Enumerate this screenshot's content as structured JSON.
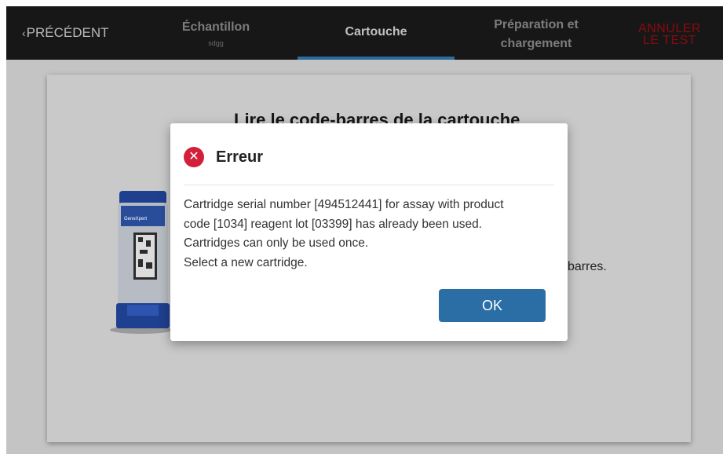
{
  "nav": {
    "back_label": "PRÉCÉDENT",
    "steps": [
      {
        "title": "Échantillon",
        "subtitle": "sdgg"
      },
      {
        "title": "Cartouche"
      },
      {
        "title_line1": "Préparation et",
        "title_line2": "chargement"
      }
    ],
    "cancel_line1": "ANNULER",
    "cancel_line2": "LE TEST",
    "active_step": "Cartouche"
  },
  "card": {
    "title": "Lire le code-barres de la cartouche",
    "hint_fragment": "barres.",
    "cartridge_brand": "GeneXpert"
  },
  "dialog": {
    "title": "Erreur",
    "icon": "error-x-icon",
    "lines": [
      "Cartridge serial number [494512441] for assay with product",
      "code [1034] reagent lot [03399] has already been used.",
      "Cartridges can only be used once.",
      "Select a new cartridge."
    ],
    "ok_label": "OK"
  },
  "colors": {
    "topbar": "#171717",
    "accent": "#2a6ea5",
    "error": "#d3203a",
    "cancel": "#8a0b12",
    "overlay": "#c4c4c4"
  }
}
